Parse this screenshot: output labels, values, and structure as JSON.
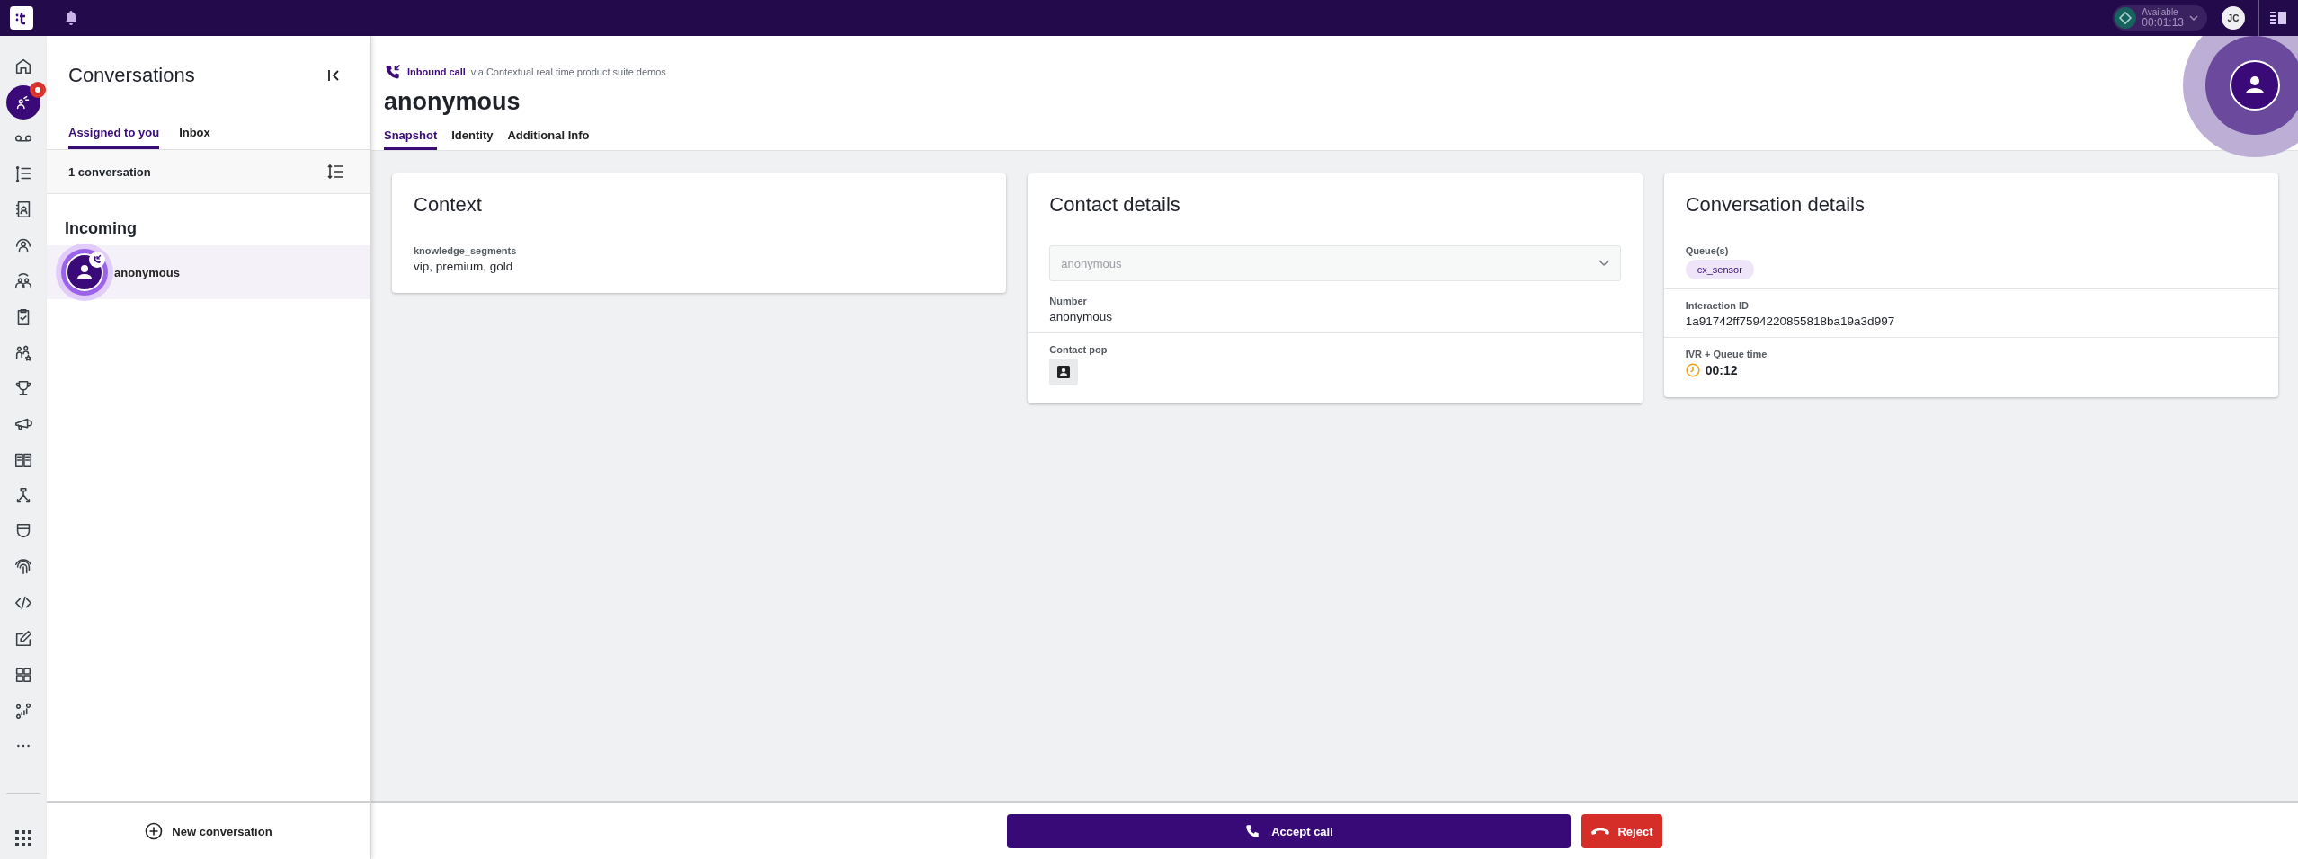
{
  "topbar": {
    "status": {
      "label": "Available",
      "time": "00:01:13"
    },
    "user_initials": "JC"
  },
  "rail": [
    {
      "kind": "home",
      "selected": false,
      "badge": false
    },
    {
      "kind": "conversations",
      "selected": true,
      "badge": true
    },
    {
      "kind": "voicemail",
      "selected": false,
      "badge": false
    },
    {
      "kind": "list",
      "selected": false,
      "badge": false
    },
    {
      "kind": "contacts",
      "selected": false,
      "badge": false
    },
    {
      "kind": "person",
      "selected": false,
      "badge": false
    },
    {
      "kind": "group",
      "selected": false,
      "badge": false
    },
    {
      "kind": "clipboard",
      "selected": false,
      "badge": false
    },
    {
      "kind": "people-star",
      "selected": false,
      "badge": false
    },
    {
      "kind": "trophy",
      "selected": false,
      "badge": false
    },
    {
      "kind": "megaphone",
      "selected": false,
      "badge": false
    },
    {
      "kind": "book",
      "selected": false,
      "badge": false
    },
    {
      "kind": "hierarchy",
      "selected": false,
      "badge": false
    },
    {
      "kind": "shield",
      "selected": false,
      "badge": false
    },
    {
      "kind": "fingerprint",
      "selected": false,
      "badge": false
    },
    {
      "kind": "code",
      "selected": false,
      "badge": false
    },
    {
      "kind": "edit",
      "selected": false,
      "badge": false
    },
    {
      "kind": "grid",
      "selected": false,
      "badge": false
    },
    {
      "kind": "chart",
      "selected": false,
      "badge": false
    },
    {
      "kind": "more",
      "selected": false,
      "badge": false
    }
  ],
  "conversations": {
    "title": "Conversations",
    "tabs": [
      {
        "label": "Assigned to you",
        "selected": true
      },
      {
        "label": "Inbox",
        "selected": false
      }
    ],
    "count": "1 conversation",
    "groups": [
      {
        "title": "Incoming",
        "items": [
          {
            "name": "anonymous",
            "selected": true
          }
        ]
      }
    ],
    "new_button": "New conversation"
  },
  "header": {
    "channel": "Inbound call",
    "via": "via Contextual real time product suite demos",
    "title": "anonymous",
    "tabs": [
      {
        "label": "Snapshot",
        "selected": true
      },
      {
        "label": "Identity",
        "selected": false
      },
      {
        "label": "Additional Info",
        "selected": false
      }
    ]
  },
  "cards": [
    {
      "title": "Context",
      "sections": [
        {
          "kind": "text",
          "label": "knowledge_segments",
          "value": "vip, premium, gold"
        }
      ]
    },
    {
      "title": "Contact details",
      "sections": [
        {
          "kind": "select",
          "value": "anonymous",
          "disabled": true
        },
        {
          "kind": "text",
          "label": "Number",
          "value": "anonymous"
        },
        {
          "kind": "icon-button",
          "label": "Contact pop"
        }
      ]
    },
    {
      "title": "Conversation details",
      "sections": [
        {
          "kind": "tag",
          "label": "Queue(s)",
          "value": "cx_sensor"
        },
        {
          "kind": "text",
          "label": "Interaction ID",
          "value": "1a91742ff7594220855818ba19a3d997"
        },
        {
          "kind": "timer",
          "label": "IVR + Queue time",
          "value": "00:12"
        }
      ]
    }
  ],
  "actions": {
    "accept": "Accept call",
    "reject": "Reject"
  }
}
